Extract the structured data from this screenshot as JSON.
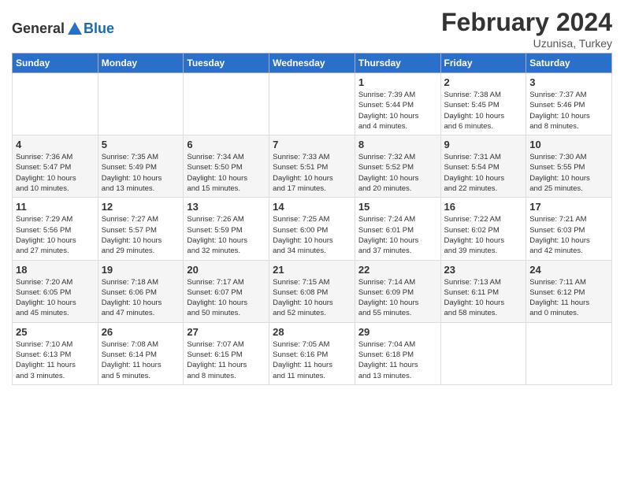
{
  "header": {
    "logo_general": "General",
    "logo_blue": "Blue",
    "month_title": "February 2024",
    "subtitle": "Uzunisa, Turkey"
  },
  "days_of_week": [
    "Sunday",
    "Monday",
    "Tuesday",
    "Wednesday",
    "Thursday",
    "Friday",
    "Saturday"
  ],
  "weeks": [
    [
      {
        "day": "",
        "info": ""
      },
      {
        "day": "",
        "info": ""
      },
      {
        "day": "",
        "info": ""
      },
      {
        "day": "",
        "info": ""
      },
      {
        "day": "1",
        "info": "Sunrise: 7:39 AM\nSunset: 5:44 PM\nDaylight: 10 hours\nand 4 minutes."
      },
      {
        "day": "2",
        "info": "Sunrise: 7:38 AM\nSunset: 5:45 PM\nDaylight: 10 hours\nand 6 minutes."
      },
      {
        "day": "3",
        "info": "Sunrise: 7:37 AM\nSunset: 5:46 PM\nDaylight: 10 hours\nand 8 minutes."
      }
    ],
    [
      {
        "day": "4",
        "info": "Sunrise: 7:36 AM\nSunset: 5:47 PM\nDaylight: 10 hours\nand 10 minutes."
      },
      {
        "day": "5",
        "info": "Sunrise: 7:35 AM\nSunset: 5:49 PM\nDaylight: 10 hours\nand 13 minutes."
      },
      {
        "day": "6",
        "info": "Sunrise: 7:34 AM\nSunset: 5:50 PM\nDaylight: 10 hours\nand 15 minutes."
      },
      {
        "day": "7",
        "info": "Sunrise: 7:33 AM\nSunset: 5:51 PM\nDaylight: 10 hours\nand 17 minutes."
      },
      {
        "day": "8",
        "info": "Sunrise: 7:32 AM\nSunset: 5:52 PM\nDaylight: 10 hours\nand 20 minutes."
      },
      {
        "day": "9",
        "info": "Sunrise: 7:31 AM\nSunset: 5:54 PM\nDaylight: 10 hours\nand 22 minutes."
      },
      {
        "day": "10",
        "info": "Sunrise: 7:30 AM\nSunset: 5:55 PM\nDaylight: 10 hours\nand 25 minutes."
      }
    ],
    [
      {
        "day": "11",
        "info": "Sunrise: 7:29 AM\nSunset: 5:56 PM\nDaylight: 10 hours\nand 27 minutes."
      },
      {
        "day": "12",
        "info": "Sunrise: 7:27 AM\nSunset: 5:57 PM\nDaylight: 10 hours\nand 29 minutes."
      },
      {
        "day": "13",
        "info": "Sunrise: 7:26 AM\nSunset: 5:59 PM\nDaylight: 10 hours\nand 32 minutes."
      },
      {
        "day": "14",
        "info": "Sunrise: 7:25 AM\nSunset: 6:00 PM\nDaylight: 10 hours\nand 34 minutes."
      },
      {
        "day": "15",
        "info": "Sunrise: 7:24 AM\nSunset: 6:01 PM\nDaylight: 10 hours\nand 37 minutes."
      },
      {
        "day": "16",
        "info": "Sunrise: 7:22 AM\nSunset: 6:02 PM\nDaylight: 10 hours\nand 39 minutes."
      },
      {
        "day": "17",
        "info": "Sunrise: 7:21 AM\nSunset: 6:03 PM\nDaylight: 10 hours\nand 42 minutes."
      }
    ],
    [
      {
        "day": "18",
        "info": "Sunrise: 7:20 AM\nSunset: 6:05 PM\nDaylight: 10 hours\nand 45 minutes."
      },
      {
        "day": "19",
        "info": "Sunrise: 7:18 AM\nSunset: 6:06 PM\nDaylight: 10 hours\nand 47 minutes."
      },
      {
        "day": "20",
        "info": "Sunrise: 7:17 AM\nSunset: 6:07 PM\nDaylight: 10 hours\nand 50 minutes."
      },
      {
        "day": "21",
        "info": "Sunrise: 7:15 AM\nSunset: 6:08 PM\nDaylight: 10 hours\nand 52 minutes."
      },
      {
        "day": "22",
        "info": "Sunrise: 7:14 AM\nSunset: 6:09 PM\nDaylight: 10 hours\nand 55 minutes."
      },
      {
        "day": "23",
        "info": "Sunrise: 7:13 AM\nSunset: 6:11 PM\nDaylight: 10 hours\nand 58 minutes."
      },
      {
        "day": "24",
        "info": "Sunrise: 7:11 AM\nSunset: 6:12 PM\nDaylight: 11 hours\nand 0 minutes."
      }
    ],
    [
      {
        "day": "25",
        "info": "Sunrise: 7:10 AM\nSunset: 6:13 PM\nDaylight: 11 hours\nand 3 minutes."
      },
      {
        "day": "26",
        "info": "Sunrise: 7:08 AM\nSunset: 6:14 PM\nDaylight: 11 hours\nand 5 minutes."
      },
      {
        "day": "27",
        "info": "Sunrise: 7:07 AM\nSunset: 6:15 PM\nDaylight: 11 hours\nand 8 minutes."
      },
      {
        "day": "28",
        "info": "Sunrise: 7:05 AM\nSunset: 6:16 PM\nDaylight: 11 hours\nand 11 minutes."
      },
      {
        "day": "29",
        "info": "Sunrise: 7:04 AM\nSunset: 6:18 PM\nDaylight: 11 hours\nand 13 minutes."
      },
      {
        "day": "",
        "info": ""
      },
      {
        "day": "",
        "info": ""
      }
    ]
  ]
}
